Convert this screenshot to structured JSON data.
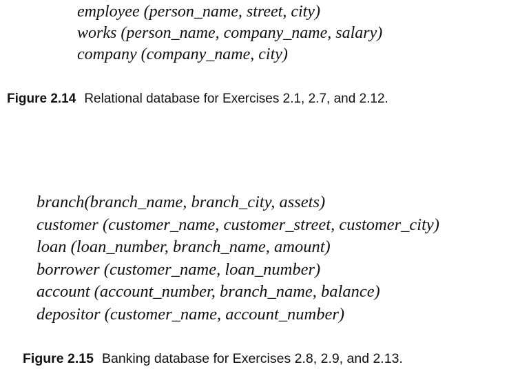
{
  "figure_2_14": {
    "schemas": [
      "employee (person_name, street, city)",
      "works (person_name, company_name, salary)",
      "company (company_name, city)"
    ],
    "caption_label": "Figure 2.14",
    "caption_text": "Relational database for Exercises 2.1, 2.7, and 2.12."
  },
  "figure_2_15": {
    "schemas": [
      "branch(branch_name, branch_city, assets)",
      "customer (customer_name, customer_street, customer_city)",
      "loan (loan_number, branch_name, amount)",
      "borrower (customer_name, loan_number)",
      "account (account_number, branch_name, balance)",
      "depositor (customer_name, account_number)"
    ],
    "caption_label": "Figure 2.15",
    "caption_text": "Banking database for Exercises 2.8, 2.9, and 2.13."
  }
}
